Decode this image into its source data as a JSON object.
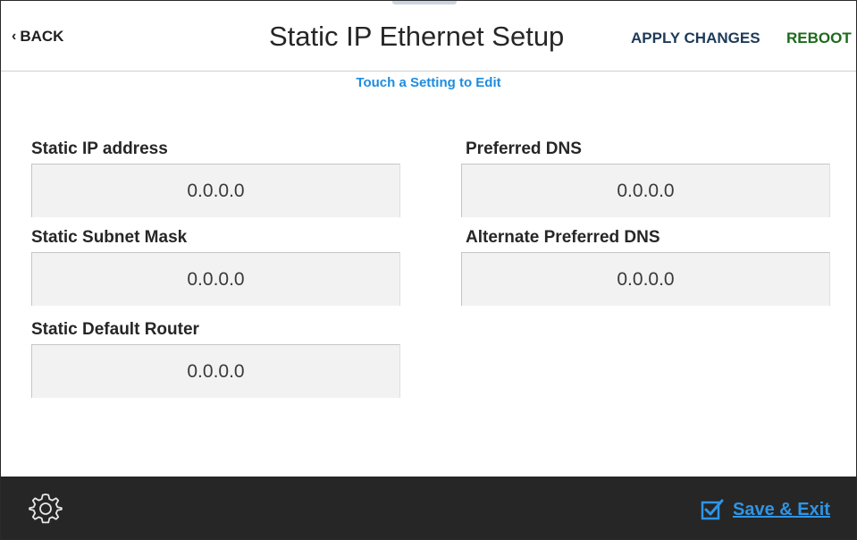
{
  "header": {
    "back_label": "BACK",
    "title": "Static IP Ethernet Setup",
    "apply_label": "APPLY CHANGES",
    "reboot_label": "REBOOT"
  },
  "hint": "Touch a Setting to Edit",
  "fields": {
    "static_ip": {
      "label": "Static IP address",
      "value": "0.0.0.0"
    },
    "subnet_mask": {
      "label": "Static Subnet Mask",
      "value": "0.0.0.0"
    },
    "default_router": {
      "label": "Static Default Router",
      "value": "0.0.0.0"
    },
    "preferred_dns": {
      "label": "Preferred DNS",
      "value": "0.0.0.0"
    },
    "alternate_dns": {
      "label": "Alternate Preferred DNS",
      "value": "0.0.0.0"
    }
  },
  "footer": {
    "settings_icon": "gear-icon",
    "save_icon": "checkbox-checked-icon",
    "save_label": "Save & Exit"
  },
  "colors": {
    "accent_blue": "#2e95e6",
    "apply_color": "#1d3a5a",
    "reboot_color": "#1c6b1c",
    "footer_bg": "#262626"
  }
}
